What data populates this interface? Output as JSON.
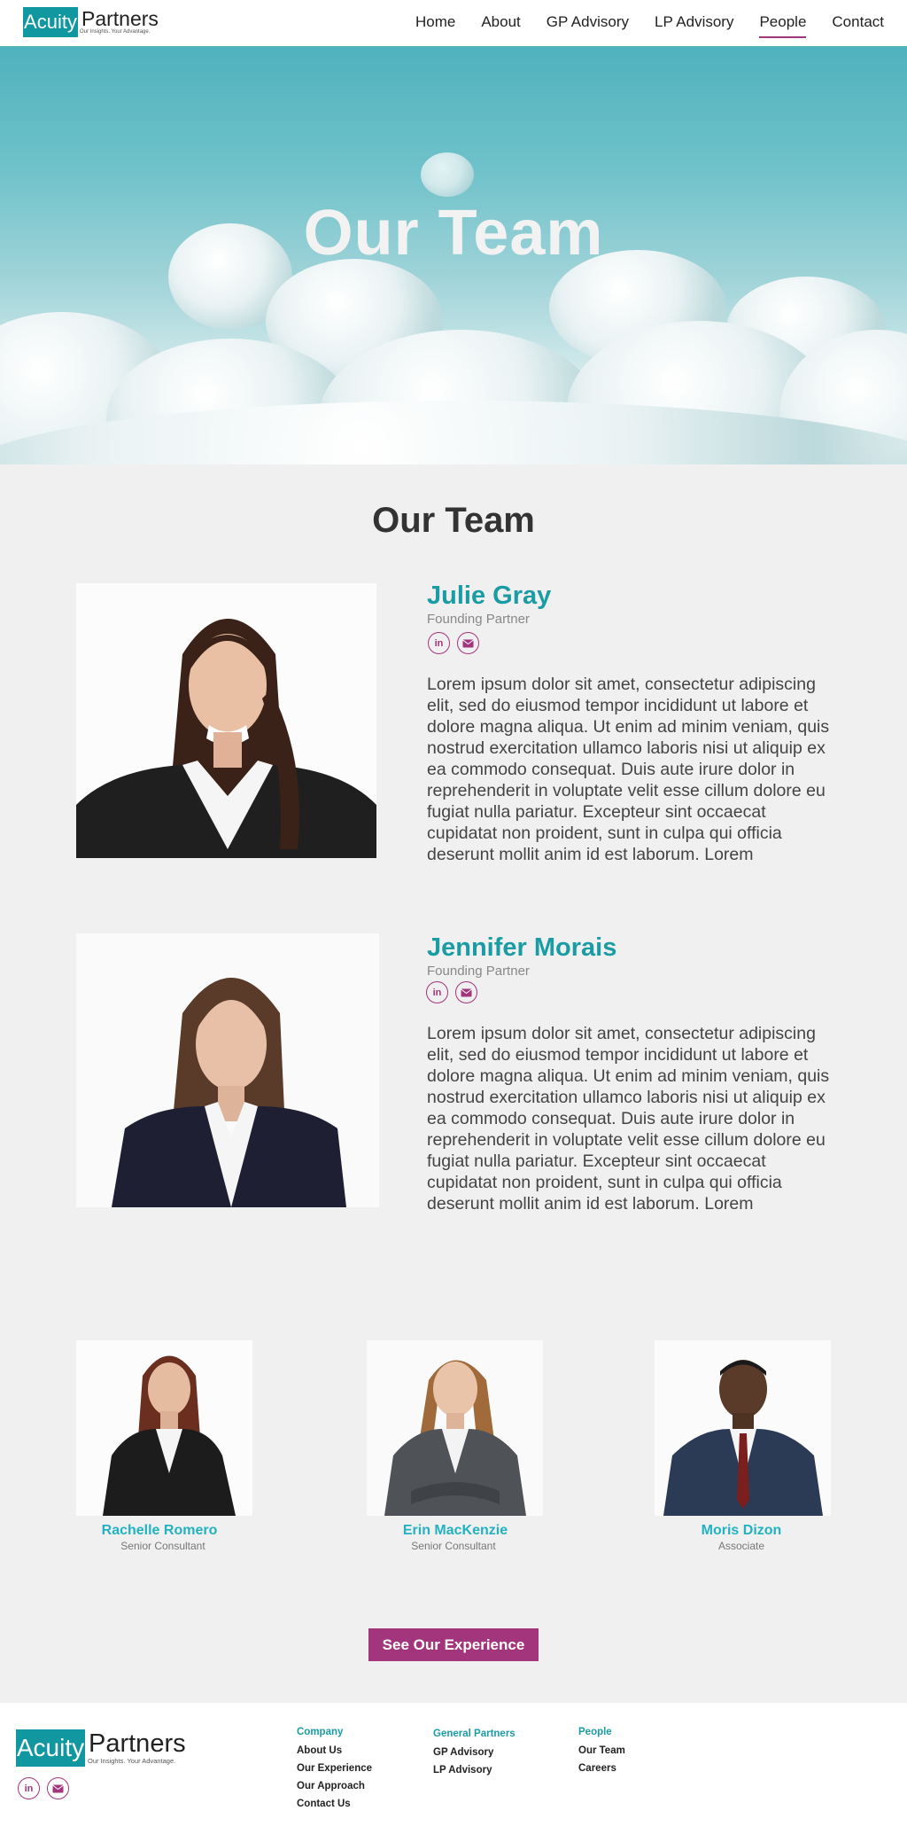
{
  "brand": {
    "logo_box": "Acuity",
    "logo_word": "Partners",
    "tagline": "Our Insights. Your Advantage."
  },
  "nav": {
    "items": [
      "Home",
      "About",
      "GP Advisory",
      "LP Advisory",
      "People",
      "Contact"
    ],
    "active": "People"
  },
  "hero": {
    "title": "Our Team"
  },
  "section": {
    "title": "Our Team"
  },
  "featured": [
    {
      "name": "Julie Gray",
      "role": "Founding Partner",
      "bio": "Lorem ipsum dolor sit amet, consectetur adipiscing elit, sed do eiusmod tempor incididunt ut labore et dolore magna aliqua. Ut enim ad minim veniam, quis nostrud exercitation ullamco laboris nisi ut aliquip ex ea commodo consequat. Duis aute irure dolor in reprehenderit in voluptate velit esse cillum dolore eu fugiat nulla pariatur. Excepteur sint occaecat cupidatat non proident, sunt in culpa qui officia deserunt mollit anim id est laborum. Lorem"
    },
    {
      "name": "Jennifer Morais",
      "role": "Founding Partner",
      "bio": "Lorem ipsum dolor sit amet, consectetur adipiscing elit, sed do eiusmod tempor incididunt ut labore et dolore magna aliqua. Ut enim ad minim veniam, quis nostrud exercitation ullamco laboris nisi ut aliquip ex ea commodo consequat. Duis aute irure dolor in reprehenderit in voluptate velit esse cillum dolore eu fugiat nulla pariatur. Excepteur sint occaecat cupidatat non proident, sunt in culpa qui officia deserunt mollit anim id est laborum. Lorem"
    }
  ],
  "members": [
    {
      "name": "Rachelle Romero",
      "role": "Senior Consultant"
    },
    {
      "name": "Erin MacKenzie",
      "role": "Senior Consultant"
    },
    {
      "name": "Moris Dizon",
      "role": "Associate"
    }
  ],
  "cta": {
    "label": "See Our Experience"
  },
  "social": {
    "linkedin": "in"
  },
  "icons": [
    "linkedin-icon",
    "mail-icon"
  ],
  "footer": {
    "columns": [
      {
        "title": "Company",
        "links": [
          "About Us",
          "Our Experience",
          "Our Approach",
          "Contact Us"
        ]
      },
      {
        "title": "General Partners",
        "links": [
          "GP Advisory",
          "LP Advisory"
        ]
      },
      {
        "title": "People",
        "links": [
          "Our Team",
          "Careers"
        ]
      }
    ]
  },
  "colors": {
    "teal": "#1197a0",
    "magenta": "#a3357c",
    "background": "#f0f0f0"
  }
}
